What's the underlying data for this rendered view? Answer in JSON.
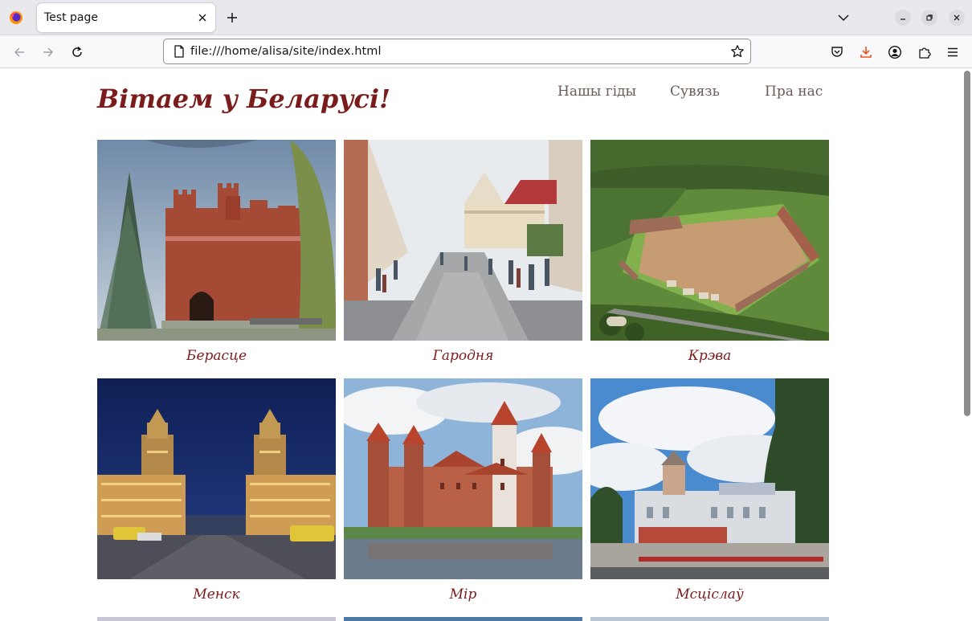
{
  "browser": {
    "tab_title": "Test page",
    "url": "file:///home/alisa/site/index.html"
  },
  "site": {
    "title": "Вітаем у Беларусі!",
    "nav": [
      "Нашы гіды",
      "Сувязь",
      "Пра нас"
    ],
    "cities": [
      {
        "name": "Берасце",
        "scene": "brick-fortress-gate"
      },
      {
        "name": "Гародня",
        "scene": "pedestrian-street"
      },
      {
        "name": "Крэва",
        "scene": "castle-ruins-aerial"
      },
      {
        "name": "Менск",
        "scene": "city-gates-night"
      },
      {
        "name": "Мір",
        "scene": "mir-castle-lake"
      },
      {
        "name": "Мсціслаў",
        "scene": "monastery-street"
      }
    ]
  },
  "colors": {
    "accent": "#7b1c1c",
    "nav_text": "#6d5a55",
    "chrome_bg": "#e9e9ed"
  }
}
